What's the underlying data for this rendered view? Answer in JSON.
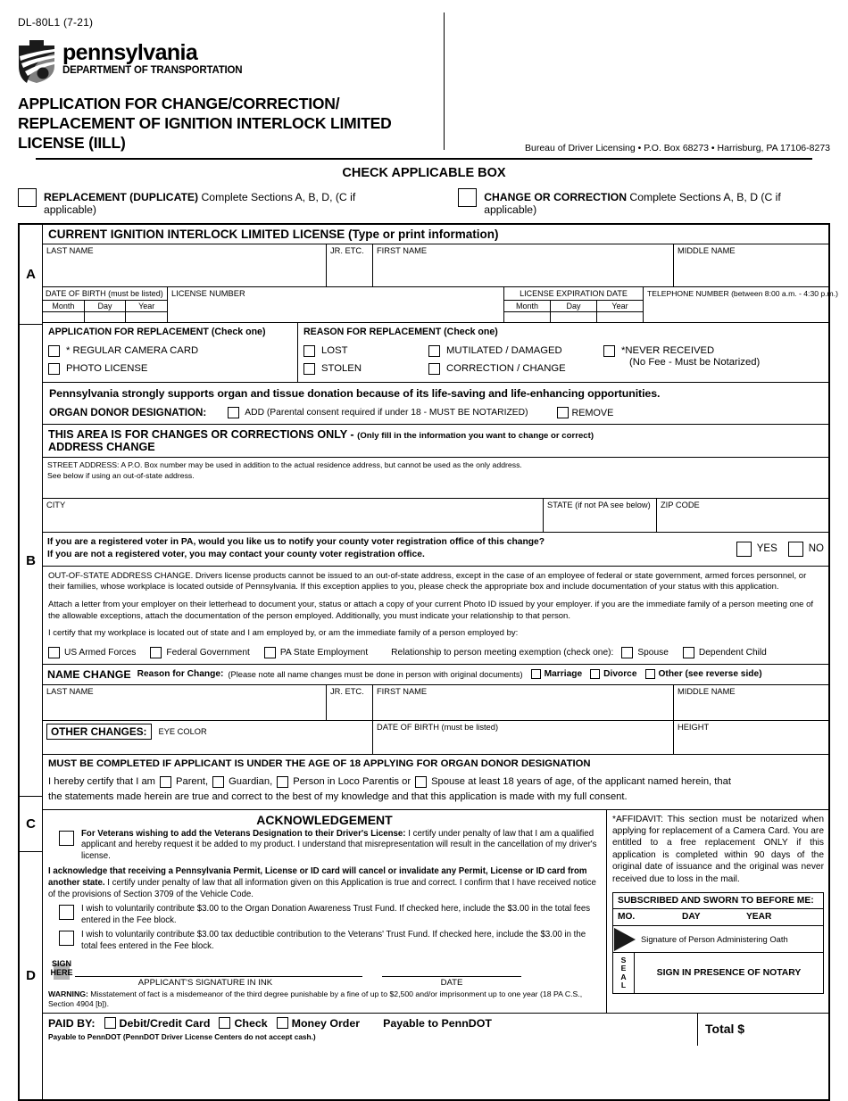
{
  "header": {
    "form_number": "DL-80L1 (7-21)",
    "logo_primary": "pennsylvania",
    "logo_secondary": "DEPARTMENT OF TRANSPORTATION",
    "title_line1": "APPLICATION FOR CHANGE/CORRECTION/",
    "title_line2": "REPLACEMENT OF IGNITION INTERLOCK LIMITED",
    "title_line3": "LICENSE (IILL)",
    "bureau_line": "Bureau of Driver Licensing • P.O. Box 68273 • Harrisburg, PA 17106-8273"
  },
  "check_applicable": {
    "heading": "CHECK APPLICABLE BOX",
    "option1_bold": "REPLACEMENT (DUPLICATE)",
    "option1_rest": " Complete Sections A, B, D, (C if applicable)",
    "option2_bold": "CHANGE OR CORRECTION",
    "option2_rest": " Complete Sections A, B, D (C if applicable)"
  },
  "sections": {
    "a_letter": "A",
    "b_letter": "B",
    "c_letter": "C",
    "d_letter": "D"
  },
  "section_a": {
    "bar_title": "CURRENT IGNITION INTERLOCK LIMITED LICENSE (Type or print information)",
    "last_name": "LAST NAME",
    "jr_etc": "JR. ETC.",
    "first_name": "FIRST NAME",
    "middle_name": "MIDDLE NAME",
    "dob_label": "DATE OF BIRTH (must be listed)",
    "month": "Month",
    "day": "Day",
    "year": "Year",
    "license_number": "LICENSE NUMBER",
    "exp_label": "LICENSE EXPIRATION DATE",
    "telephone": "TELEPHONE NUMBER (between 8:00 a.m. - 4:30 p.m.)"
  },
  "replacement": {
    "app_heading": "APPLICATION FOR REPLACEMENT (Check one)",
    "app_options": [
      "* REGULAR CAMERA CARD",
      "PHOTO LICENSE"
    ],
    "reason_heading": "REASON FOR REPLACEMENT (Check one)",
    "reason_col1": [
      "LOST",
      "STOLEN"
    ],
    "reason_col2": [
      "MUTILATED / DAMAGED",
      "CORRECTION / CHANGE"
    ],
    "never_received": "*NEVER RECEIVED",
    "never_received_sub": "(No Fee - Must be Notarized)"
  },
  "organ": {
    "statement": "Pennsylvania strongly supports organ and tissue donation because of its life-saving and life-enhancing opportunities.",
    "designation_label": "ORGAN DONOR DESIGNATION:",
    "add_label": "ADD (Parental consent required if under 18 - MUST BE NOTARIZED)",
    "remove_label": "REMOVE"
  },
  "changes": {
    "heading_bold": "THIS AREA IS FOR CHANGES OR CORRECTIONS ONLY - ",
    "heading_note": "(Only fill in the information you want to change or correct)",
    "address_change": "ADDRESS CHANGE",
    "street_line1": "STREET ADDRESS: A P.O. Box number may be used in addition to the actual residence address, but cannot be used as the only address.",
    "street_line2": "See below if using an out-of-state address.",
    "city": "CITY",
    "state": "STATE (if not PA see below)",
    "zip": "ZIP CODE"
  },
  "voter": {
    "line1": "If you are a registered voter in PA, would you like us to notify your county voter registration office of this change?",
    "line2": "If you are not a registered voter, you may contact your county voter registration office.",
    "yes": "YES",
    "no": "NO"
  },
  "out_of_state": {
    "para1": "OUT-OF-STATE ADDRESS CHANGE. Drivers license products cannot be issued to an out-of-state address, except in the case of an employee of federal or state government, armed forces personnel, or their families, whose workplace is located outside of Pennsylvania. If this exception applies to you, please check the appropriate box and include documentation of your status with this application.",
    "para2": "Attach a letter from your employer on their letterhead to document your, status or attach a copy of your current Photo ID issued by your employer. if you are the immediate family of a person meeting one of the allowable exceptions, attach the documentation of the person employed. Additionally, you must indicate your relationship to that person.",
    "para3": "I certify that my workplace is located out of state and I am employed by, or am the immediate family of a person employed by:",
    "opt1": "US Armed Forces",
    "opt2": "Federal Government",
    "opt3": "PA State Employment",
    "relationship_label": "Relationship to person meeting exemption (check one):",
    "rel1": "Spouse",
    "rel2": "Dependent Child"
  },
  "name_change": {
    "heading": "NAME CHANGE",
    "reason_label": "Reason for Change:",
    "note": "(Please note all name changes must be done in person with original documents)",
    "opt1": "Marriage",
    "opt2": "Divorce",
    "opt3": "Other (see reverse side)",
    "last_name": "LAST NAME",
    "jr_etc": "JR. ETC.",
    "first_name": "FIRST NAME",
    "middle_name": "MIDDLE NAME"
  },
  "other_changes": {
    "badge": "OTHER CHANGES:",
    "eye_color": "EYE COLOR",
    "dob": "DATE OF BIRTH (must be listed)",
    "height": "HEIGHT"
  },
  "section_c": {
    "heading": "MUST BE COMPLETED IF APPLICANT IS UNDER THE AGE OF 18 APPLYING FOR ORGAN DONOR DESIGNATION",
    "lead": "I hereby certify that I am",
    "opt1": "Parent,",
    "opt2": "Guardian,",
    "opt3": "Person in Loco Parentis or",
    "opt4": "Spouse at least 18 years of age, of the applicant named herein, that",
    "tail": "the statements made herein are true and correct to the best of my knowledge and that this application is made with my full consent."
  },
  "section_d": {
    "ack_heading": "ACKNOWLEDGEMENT",
    "veterans_bold": "For Veterans wishing to add the Veterans Designation to their Driver's License:",
    "veterans_rest": " I certify under penalty of law that I am a qualified applicant and hereby request it be added to my product. I understand that misrepresentation will result in the cancellation of my driver's license.",
    "ack_bold": "I acknowledge that receiving a Pennsylvania Permit, License or ID card will cancel or invalidate any Permit, License or ID card from another state.",
    "ack_rest": " I certify under penalty of law that all information given on this Application is true and correct. I confirm that I have received notice of the provisions of Section 3709 of the Vehicle Code.",
    "organ_fund": "I wish to voluntarily contribute $3.00 to the Organ Donation Awareness Trust Fund. If checked here, include the $3.00 in the total fees entered in the Fee block.",
    "veterans_fund": "I wish to voluntarily contribute $3.00 tax deductible contribution to the Veterans' Trust Fund. If checked here, include the $3.00 in the total fees entered in the Fee block.",
    "sign_here_1": "SIGN",
    "sign_here_2": "HERE",
    "sig_caption": "APPLICANT'S SIGNATURE IN INK",
    "date_caption": "DATE",
    "warning_bold": "WARNING:",
    "warning_rest": " Misstatement of fact is a misdemeanor of the third degree punishable by a fine of up to $2,500 and/or imprisonment up to one year (18 PA C.S., Section 4904 [b])."
  },
  "affidavit": {
    "text": "*AFFIDAVIT: This section must be notarized when applying for replacement of a Camera Card. You are entitled to a free replacement ONLY if this application is completed within 90 days of the original date of issuance and the original was never received due to loss in the mail.",
    "notary_heading": "SUBSCRIBED AND SWORN TO BEFORE ME:",
    "mo": "MO.",
    "day": "DAY",
    "year": "YEAR",
    "oath_line": "Signature of Person Administering Oath",
    "seal_letters": [
      "S",
      "E",
      "A",
      "L"
    ],
    "sign_presence": "SIGN IN PRESENCE OF NOTARY"
  },
  "paid_by": {
    "label": "PAID BY:",
    "opt1": "Debit/Credit Card",
    "opt2": "Check",
    "opt3": "Money Order",
    "payable": "Payable to PennDOT",
    "note": "Payable to PennDOT (PennDOT Driver License Centers do not accept cash.)",
    "total": "Total $"
  }
}
